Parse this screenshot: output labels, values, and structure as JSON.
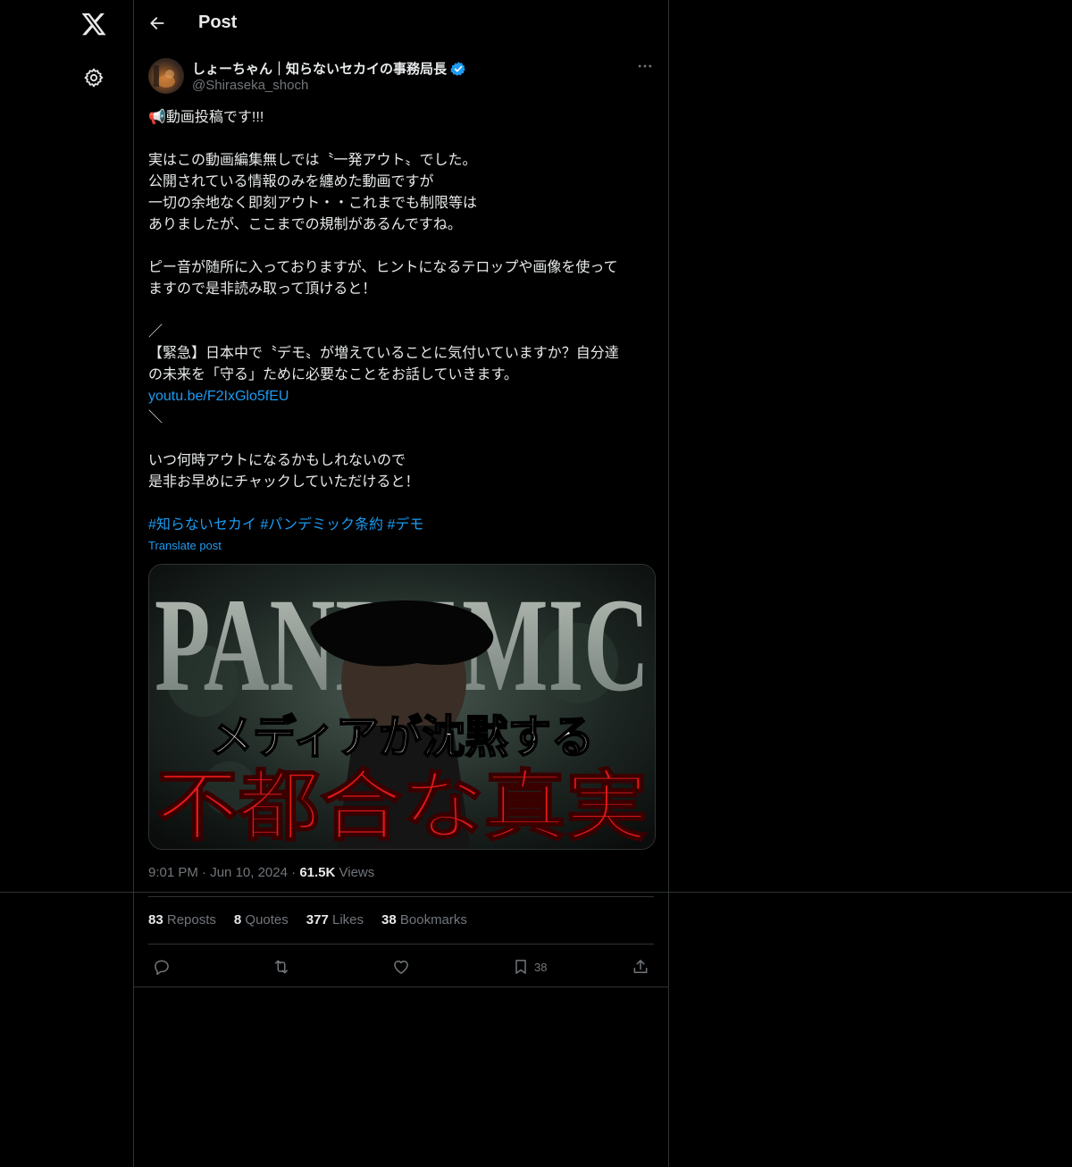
{
  "header": {
    "title": "Post"
  },
  "nav": {
    "logo_icon": "x-logo-icon",
    "settings_icon": "gear-icon"
  },
  "author": {
    "name": "しょーちゃん｜知らないセカイの事務局長",
    "handle": "@Shiraseka_shoch"
  },
  "tweet": {
    "paragraphs": [
      [
        "📢動画投稿です!!!"
      ],
      [
        "実はこの動画編集無しでは〝一発アウト〟でした。",
        "公開されている情報のみを纏めた動画ですが",
        "一切の余地なく即刻アウト・・これまでも制限等は",
        "ありましたが、ここまでの規制があるんですね。"
      ],
      [
        "ピー音が随所に入っておりますが、ヒントになるテロップや画像を使って",
        "ますので是非読み取って頂けると！"
      ]
    ],
    "quote_open": "／",
    "quote_line1": "【緊急】日本中で〝デモ〟が増えていることに気付いていますか？自分達",
    "quote_line2": "の未来を「守る」ために必要なことをお話していきます。",
    "link": "youtu.be/F2IxGlo5fEU",
    "quote_close": "＼",
    "closing": [
      "いつ何時アウトになるかもしれないので",
      "是非お早めにチャックしていただけると！"
    ],
    "hashtags": "#知らないセカイ #パンデミック条約 #デモ",
    "translate": "Translate post"
  },
  "media": {
    "word_top": "PANDEMIC",
    "line1": "メディアが沈黙する",
    "line2": "不都合な真実"
  },
  "meta": {
    "time": "9:01 PM",
    "sep": "·",
    "date": "Jun 10, 2024",
    "views_count": "61.5K",
    "views_label": "Views"
  },
  "stats": {
    "reposts": {
      "count": "83",
      "label": "Reposts"
    },
    "quotes": {
      "count": "8",
      "label": "Quotes"
    },
    "likes": {
      "count": "377",
      "label": "Likes"
    },
    "bookmarks": {
      "count": "38",
      "label": "Bookmarks"
    }
  },
  "actions": {
    "reply_icon": "reply-icon",
    "repost_icon": "repost-icon",
    "like_icon": "heart-icon",
    "bookmark_icon": "bookmark-icon",
    "bookmark_count": "38",
    "share_icon": "share-icon"
  },
  "colors": {
    "accent": "#1d9bf0",
    "border": "#2f3336",
    "muted": "#71767b",
    "text": "#e7e9ea",
    "background": "#000000"
  }
}
